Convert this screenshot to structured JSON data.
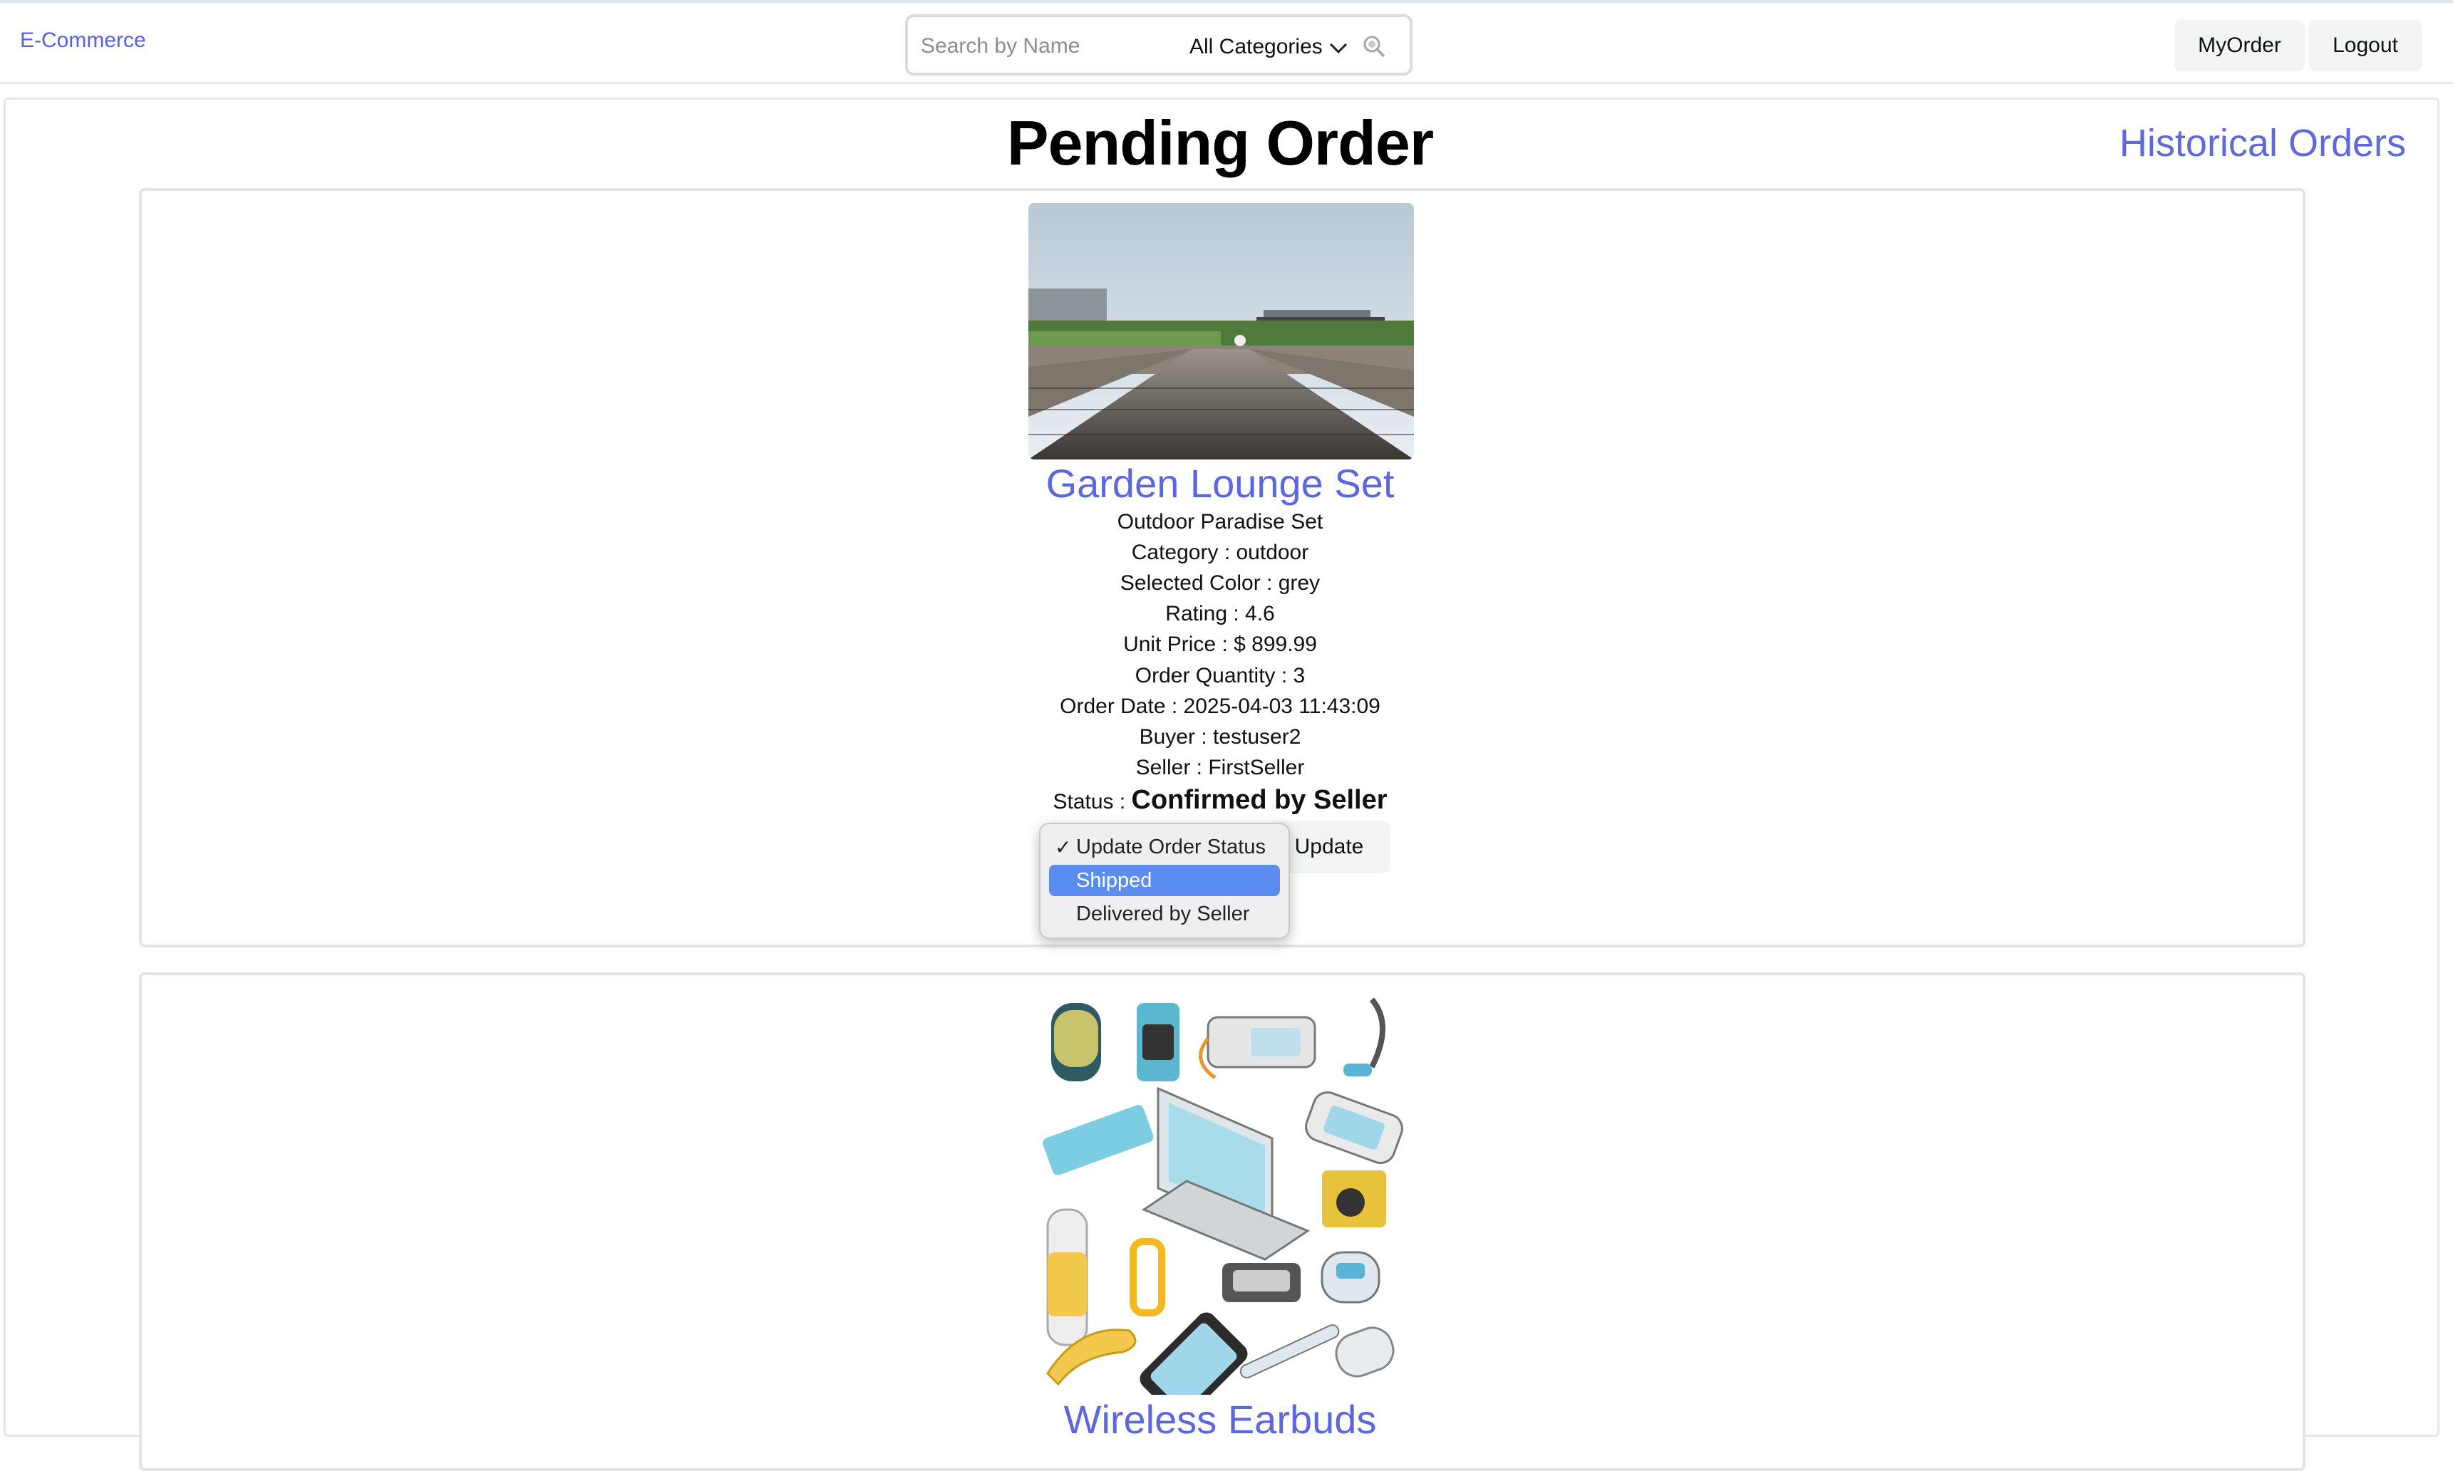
{
  "navbar": {
    "brand": "E-Commerce",
    "search_placeholder": "Search by Name",
    "category_selected": "All Categories",
    "my_order_label": "MyOrder",
    "logout_label": "Logout"
  },
  "page": {
    "title": "Pending Order",
    "historical_link": "Historical Orders"
  },
  "orders": [
    {
      "name": "Garden Lounge Set",
      "description": "Outdoor Paradise Set",
      "category": "Category : outdoor",
      "color": "Selected Color : grey",
      "rating": "Rating : 4.6",
      "unit_price": "Unit Price : $ 899.99",
      "quantity": "Order Quantity : 3",
      "order_date": "Order Date : 2025-04-03 11:43:09",
      "buyer": "Buyer : testuser2",
      "seller": "Seller : FirstSeller",
      "status_prefix": "Status : ",
      "status_value": "Confirmed by Seller",
      "update_label": "Update",
      "status_options": [
        "Update Order Status",
        "Shipped",
        "Delivered by Seller"
      ],
      "status_checked": "Update Order Status",
      "status_highlighted": "Shipped"
    },
    {
      "name": "Wireless Earbuds"
    }
  ],
  "colors": {
    "accent": "#5a67e0",
    "highlight": "#5b8df0"
  },
  "icons": {
    "search": "search-icon",
    "dropdown": "chevron-down-icon",
    "check": "checkmark-icon"
  }
}
